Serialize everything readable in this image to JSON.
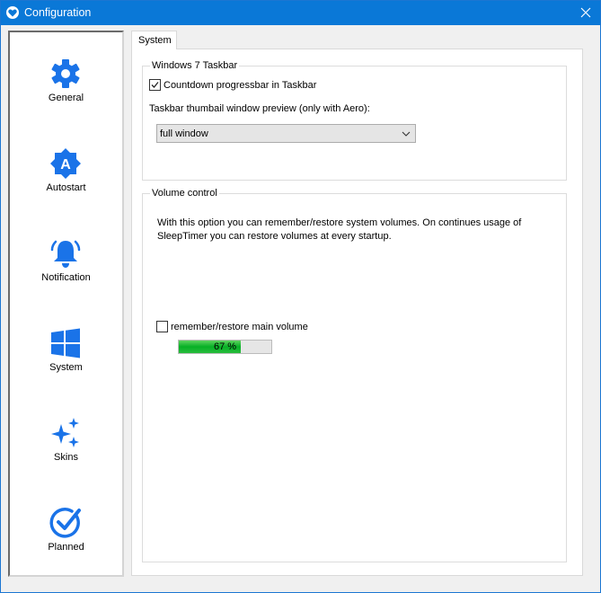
{
  "window": {
    "title": "Configuration"
  },
  "sidebar": {
    "items": [
      {
        "label": "General",
        "icon": "gear-icon"
      },
      {
        "label": "Autostart",
        "icon": "autostart-icon"
      },
      {
        "label": "Notification",
        "icon": "bell-icon"
      },
      {
        "label": "System",
        "icon": "windows-logo-icon"
      },
      {
        "label": "Skins",
        "icon": "sparkles-icon"
      },
      {
        "label": "Planned",
        "icon": "check-circle-icon"
      }
    ]
  },
  "tabs": [
    {
      "label": "System",
      "selected": true
    }
  ],
  "taskbar_group": {
    "title": "Windows 7 Taskbar",
    "countdown_checkbox": {
      "label": "Countdown progressbar in Taskbar",
      "checked": true
    },
    "preview_label": "Taskbar thumbail window preview (only with Aero):",
    "preview_select": {
      "value": "full window"
    }
  },
  "volume_group": {
    "title": "Volume control",
    "description": "With this option you can remember/restore system volumes. On continues usage of SleepTimer you can restore volumes at every startup.",
    "remember_checkbox": {
      "label": "remember/restore main volume",
      "checked": false
    },
    "volume": {
      "value": 67,
      "text": "67 %"
    }
  },
  "colors": {
    "accent": "#0a78d7",
    "icon_blue": "#1a73e8",
    "progress_green": "#06b025"
  }
}
